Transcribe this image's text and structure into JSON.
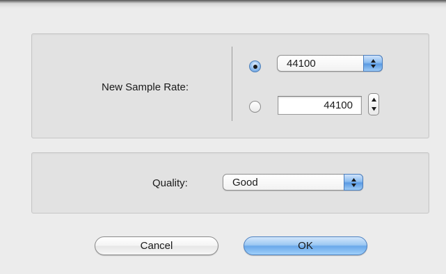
{
  "sample_rate": {
    "label": "New Sample Rate:",
    "option_popup": {
      "selected": true,
      "value": "44100"
    },
    "option_custom": {
      "selected": false,
      "value": "44100"
    }
  },
  "quality": {
    "label": "Quality:",
    "value": "Good"
  },
  "buttons": {
    "cancel": "Cancel",
    "ok": "OK"
  },
  "colors": {
    "accent": "#6aa8ea",
    "background": "#ececec"
  },
  "icons": {
    "popup_arrows": "up-down-arrows-icon",
    "stepper": "stepper-arrows-icon"
  }
}
